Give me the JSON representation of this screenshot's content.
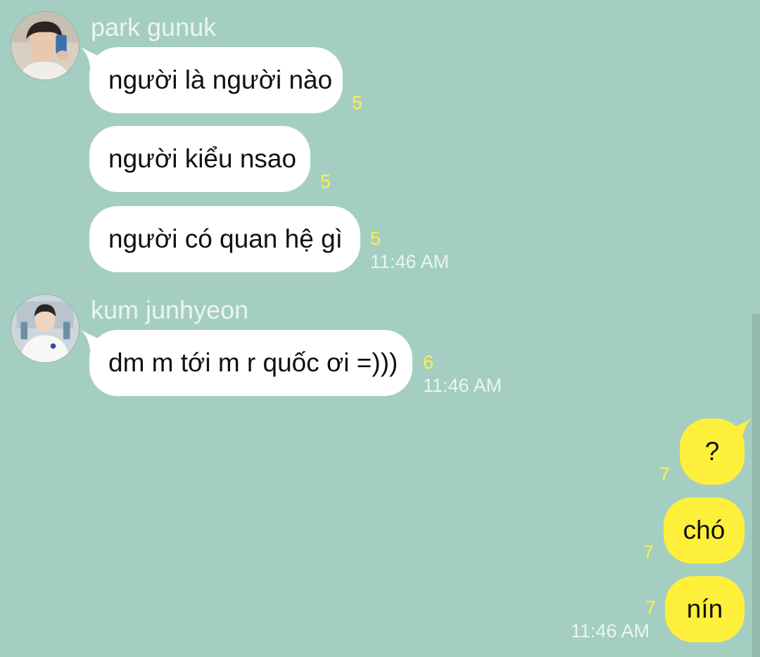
{
  "colors": {
    "background": "#a5cec2",
    "incoming_bubble": "#ffffff",
    "outgoing_bubble": "#fef03a",
    "unread_count": "#fdf04a",
    "meta_text": "#eaf5f1"
  },
  "groups": [
    {
      "sender": "park gunuk",
      "avatar_icon": "profile-photo",
      "messages": [
        {
          "text": "người là người nào",
          "unread": "5"
        },
        {
          "text": "người kiểu nsao",
          "unread": "5"
        },
        {
          "text": "người có quan hệ gì",
          "unread": "5",
          "time": "11:46 AM"
        }
      ]
    },
    {
      "sender": "kum junhyeon",
      "avatar_icon": "profile-photo",
      "messages": [
        {
          "text": "dm m tới m r quốc ơi =)))",
          "unread": "6",
          "time": "11:46 AM"
        }
      ]
    }
  ],
  "outgoing": {
    "messages": [
      {
        "text": "?",
        "unread": "7"
      },
      {
        "text": "chó",
        "unread": "7"
      },
      {
        "text": "nín",
        "unread": "7",
        "time": "11:46 AM"
      }
    ]
  }
}
